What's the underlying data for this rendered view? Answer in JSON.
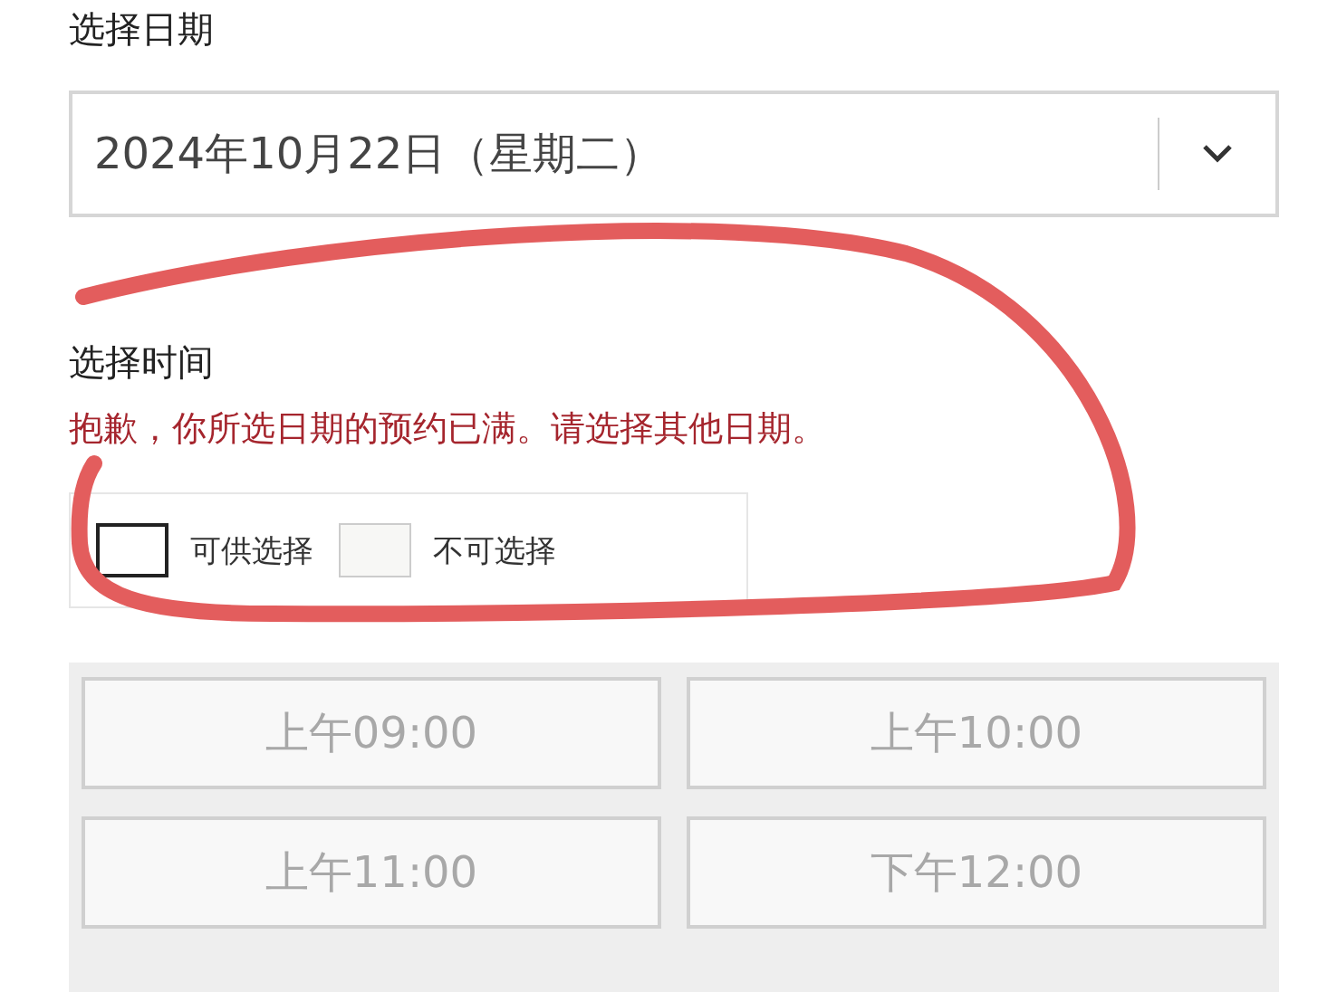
{
  "date_section": {
    "label": "选择日期",
    "select": {
      "value": "2024年10月22日（星期二）"
    }
  },
  "time_section": {
    "label": "选择时间",
    "error": "抱歉，你所选日期的预约已满。请选择其他日期。"
  },
  "legend": [
    {
      "kind": "available",
      "label": "可供选择"
    },
    {
      "kind": "unavailable",
      "label": "不可选择"
    }
  ],
  "slots": [
    {
      "label": "上午09:00",
      "disabled": true
    },
    {
      "label": "上午10:00",
      "disabled": true
    },
    {
      "label": "上午11:00",
      "disabled": true
    },
    {
      "label": "下午12:00",
      "disabled": true
    }
  ]
}
